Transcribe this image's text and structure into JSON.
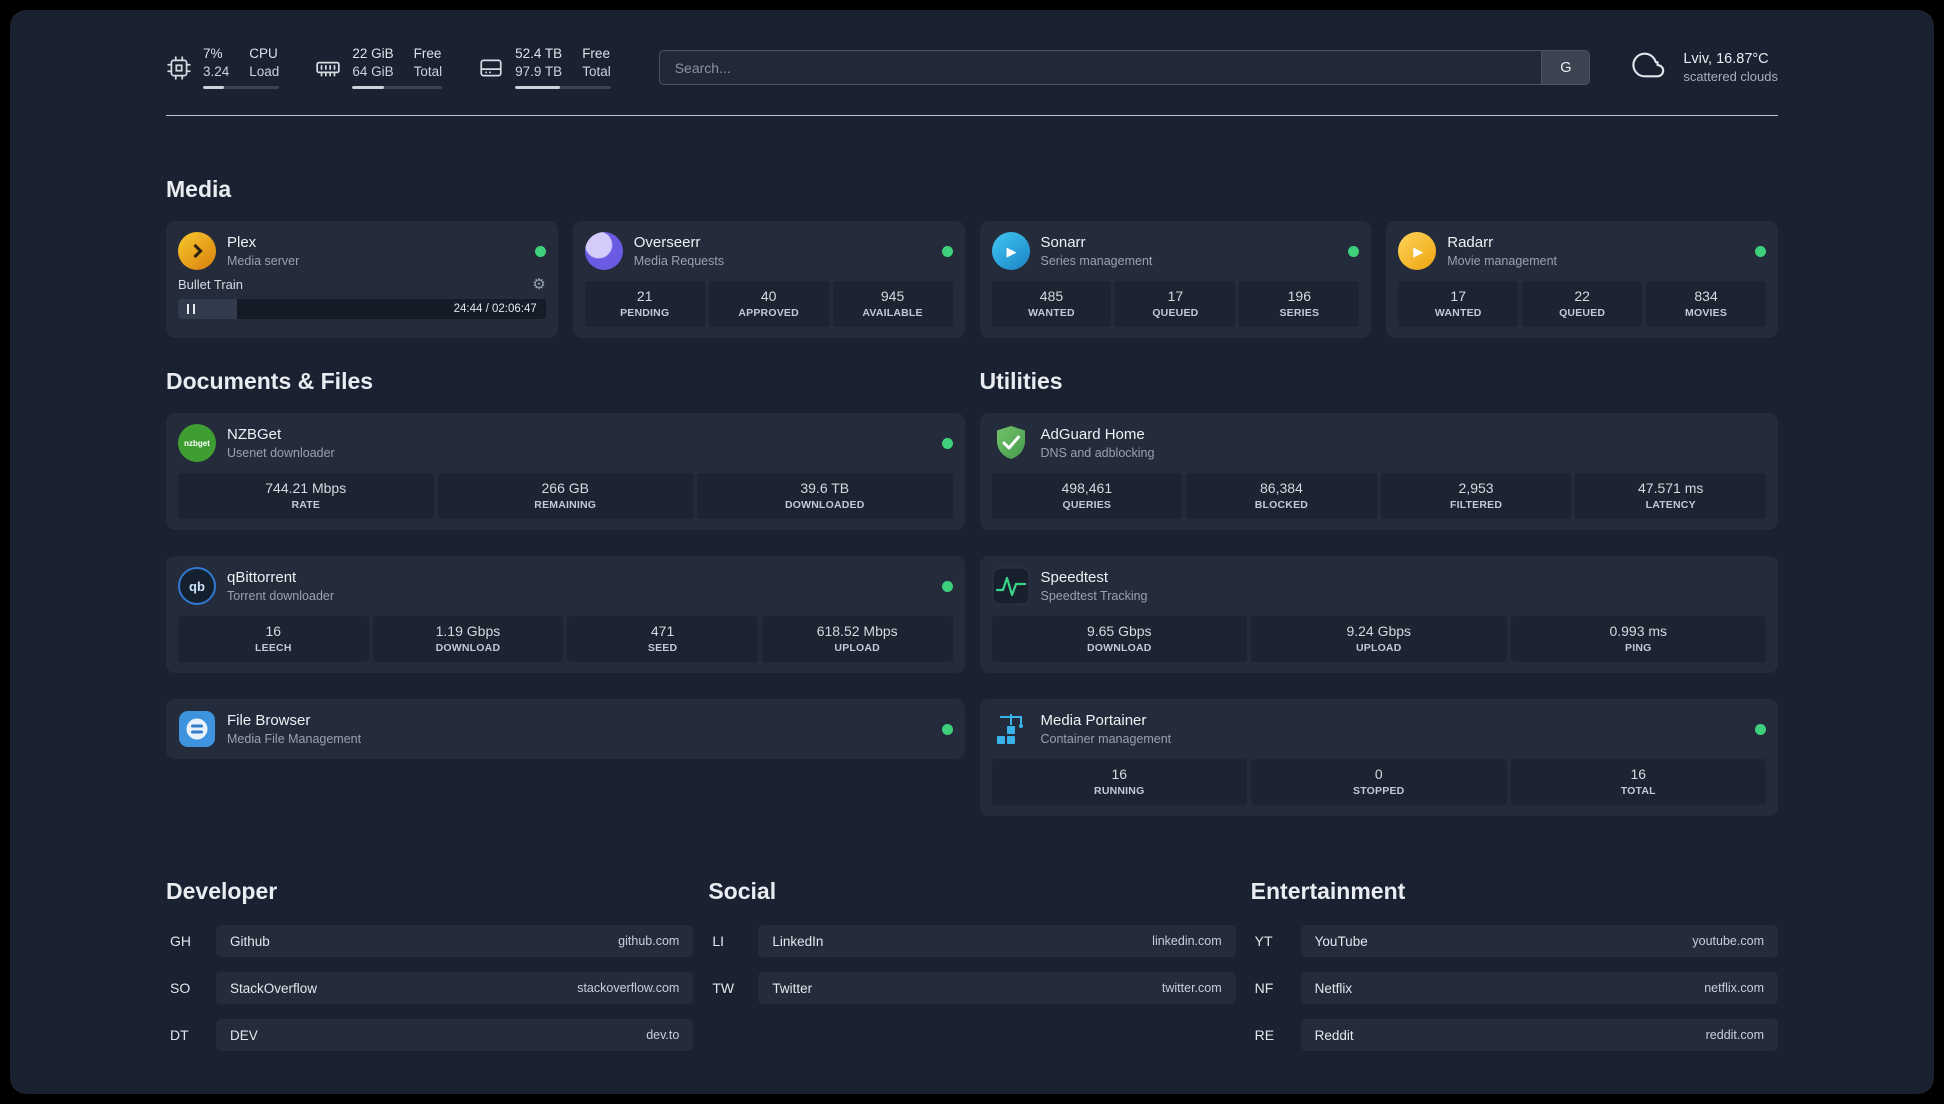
{
  "header": {
    "resources": [
      {
        "values": [
          "7%",
          "3.24"
        ],
        "labels": [
          "CPU",
          "Load"
        ],
        "progress": 28
      },
      {
        "values": [
          "22 GiB",
          "64 GiB"
        ],
        "labels": [
          "Free",
          "Total"
        ],
        "progress": 35
      },
      {
        "values": [
          "52.4 TB",
          "97.9 TB"
        ],
        "labels": [
          "Free",
          "Total"
        ],
        "progress": 47
      }
    ],
    "search": {
      "placeholder": "Search...",
      "provider": "G"
    },
    "weather": {
      "location": "Lviv, 16.87°C",
      "condition": "scattered clouds"
    }
  },
  "media": {
    "title": "Media",
    "cards": [
      {
        "name": "Plex",
        "subtitle": "Media server",
        "status": "online",
        "player": {
          "title": "Bullet Train",
          "time": "24:44 / 02:06:47",
          "progress": 16
        }
      },
      {
        "name": "Overseerr",
        "subtitle": "Media Requests",
        "status": "online",
        "stats": [
          {
            "value": "21",
            "label": "PENDING"
          },
          {
            "value": "40",
            "label": "APPROVED"
          },
          {
            "value": "945",
            "label": "AVAILABLE"
          }
        ]
      },
      {
        "name": "Sonarr",
        "subtitle": "Series management",
        "status": "online",
        "stats": [
          {
            "value": "485",
            "label": "WANTED"
          },
          {
            "value": "17",
            "label": "QUEUED"
          },
          {
            "value": "196",
            "label": "SERIES"
          }
        ]
      },
      {
        "name": "Radarr",
        "subtitle": "Movie management",
        "status": "online",
        "stats": [
          {
            "value": "17",
            "label": "WANTED"
          },
          {
            "value": "22",
            "label": "QUEUED"
          },
          {
            "value": "834",
            "label": "MOVIES"
          }
        ]
      }
    ]
  },
  "documents": {
    "title": "Documents & Files",
    "cards": [
      {
        "name": "NZBGet",
        "subtitle": "Usenet downloader",
        "status": "online",
        "stats": [
          {
            "value": "744.21 Mbps",
            "label": "RATE"
          },
          {
            "value": "266 GB",
            "label": "REMAINING"
          },
          {
            "value": "39.6 TB",
            "label": "DOWNLOADED"
          }
        ]
      },
      {
        "name": "qBittorrent",
        "subtitle": "Torrent downloader",
        "status": "online",
        "stats": [
          {
            "value": "16",
            "label": "LEECH"
          },
          {
            "value": "1.19 Gbps",
            "label": "DOWNLOAD"
          },
          {
            "value": "471",
            "label": "SEED"
          },
          {
            "value": "618.52 Mbps",
            "label": "UPLOAD"
          }
        ]
      },
      {
        "name": "File Browser",
        "subtitle": "Media File Management",
        "status": "online"
      }
    ]
  },
  "utilities": {
    "title": "Utilities",
    "cards": [
      {
        "name": "AdGuard Home",
        "subtitle": "DNS and adblocking",
        "stats": [
          {
            "value": "498,461",
            "label": "QUERIES"
          },
          {
            "value": "86,384",
            "label": "BLOCKED"
          },
          {
            "value": "2,953",
            "label": "FILTERED"
          },
          {
            "value": "47.571 ms",
            "label": "LATENCY"
          }
        ]
      },
      {
        "name": "Speedtest",
        "subtitle": "Speedtest Tracking",
        "stats": [
          {
            "value": "9.65 Gbps",
            "label": "DOWNLOAD"
          },
          {
            "value": "9.24 Gbps",
            "label": "UPLOAD"
          },
          {
            "value": "0.993 ms",
            "label": "PING"
          }
        ]
      },
      {
        "name": "Media Portainer",
        "subtitle": "Container management",
        "status": "online",
        "stats": [
          {
            "value": "16",
            "label": "RUNNING"
          },
          {
            "value": "0",
            "label": "STOPPED"
          },
          {
            "value": "16",
            "label": "TOTAL"
          }
        ]
      }
    ]
  },
  "bookmarks": [
    {
      "title": "Developer",
      "items": [
        {
          "abbr": "GH",
          "name": "Github",
          "url": "github.com"
        },
        {
          "abbr": "SO",
          "name": "StackOverflow",
          "url": "stackoverflow.com"
        },
        {
          "abbr": "DT",
          "name": "DEV",
          "url": "dev.to"
        }
      ]
    },
    {
      "title": "Social",
      "items": [
        {
          "abbr": "LI",
          "name": "LinkedIn",
          "url": "linkedin.com"
        },
        {
          "abbr": "TW",
          "name": "Twitter",
          "url": "twitter.com"
        }
      ]
    },
    {
      "title": "Entertainment",
      "items": [
        {
          "abbr": "YT",
          "name": "YouTube",
          "url": "youtube.com"
        },
        {
          "abbr": "NF",
          "name": "Netflix",
          "url": "netflix.com"
        },
        {
          "abbr": "RE",
          "name": "Reddit",
          "url": "reddit.com"
        }
      ]
    }
  ],
  "icon_glyphs": {
    "gear": "⚙",
    "play": "▶",
    "nzbget_text": "nzbget",
    "qbittorrent_text": "qb"
  },
  "colors": {
    "status_online": "#3ed07c",
    "speedtest_pulse": "#3bd588",
    "adguard_green": "#5cb157"
  }
}
